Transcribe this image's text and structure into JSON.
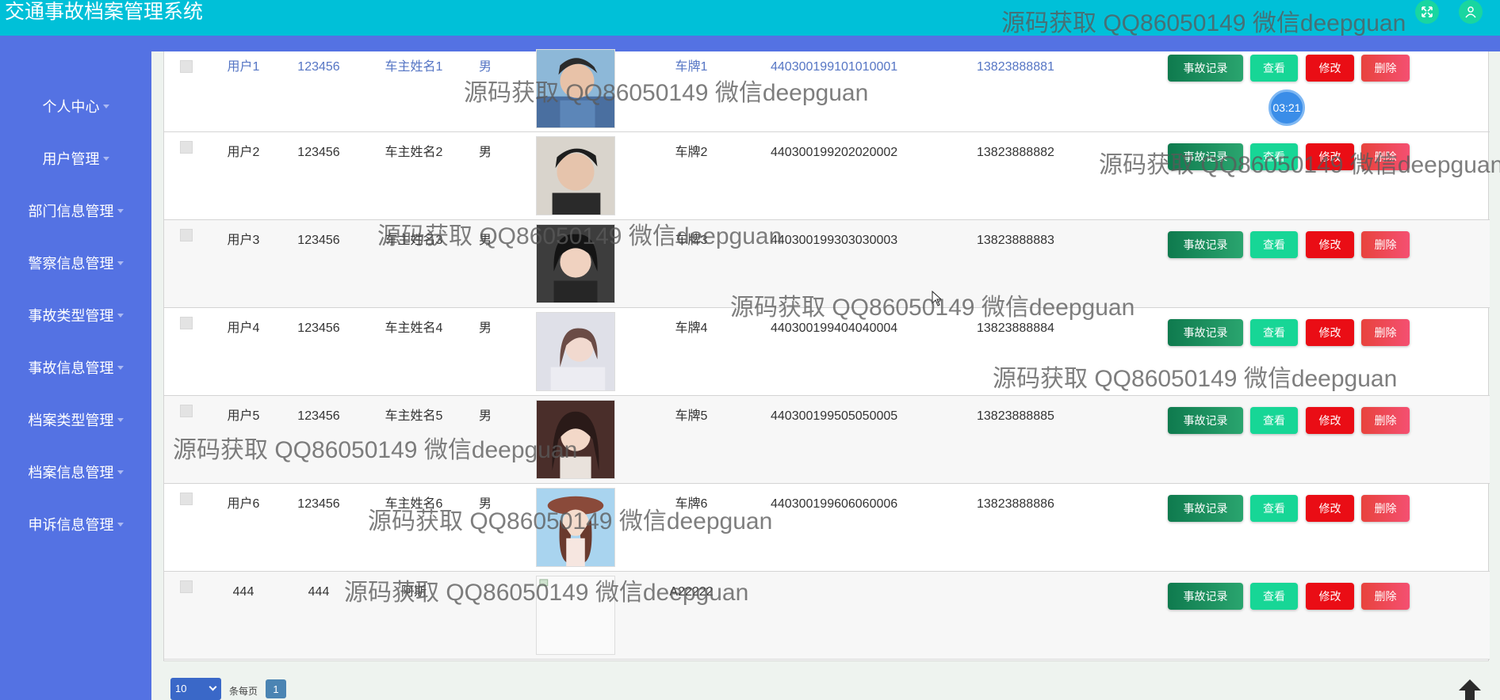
{
  "app": {
    "title": "交通事故档案管理系统"
  },
  "header": {
    "fullscreen_icon": "fullscreen-icon",
    "user_icon": "user-icon"
  },
  "sidebar": {
    "items": [
      {
        "label": "个人中心"
      },
      {
        "label": "用户管理"
      },
      {
        "label": "部门信息管理"
      },
      {
        "label": "警察信息管理"
      },
      {
        "label": "事故类型管理"
      },
      {
        "label": "事故信息管理"
      },
      {
        "label": "档案类型管理"
      },
      {
        "label": "档案信息管理"
      },
      {
        "label": "申诉信息管理"
      }
    ]
  },
  "table": {
    "rows": [
      {
        "username": "用户1",
        "password": "123456",
        "owner_name": "车主姓名1",
        "gender": "男",
        "plate": "车牌1",
        "id_number": "440300199101010001",
        "phone": "13823888881"
      },
      {
        "username": "用户2",
        "password": "123456",
        "owner_name": "车主姓名2",
        "gender": "男",
        "plate": "车牌2",
        "id_number": "440300199202020002",
        "phone": "13823888882"
      },
      {
        "username": "用户3",
        "password": "123456",
        "owner_name": "车主姓名3",
        "gender": "男",
        "plate": "车牌3",
        "id_number": "440300199303030003",
        "phone": "13823888883"
      },
      {
        "username": "用户4",
        "password": "123456",
        "owner_name": "车主姓名4",
        "gender": "男",
        "plate": "车牌4",
        "id_number": "440300199404040004",
        "phone": "13823888884"
      },
      {
        "username": "用户5",
        "password": "123456",
        "owner_name": "车主姓名5",
        "gender": "男",
        "plate": "车牌5",
        "id_number": "440300199505050005",
        "phone": "13823888885"
      },
      {
        "username": "用户6",
        "password": "123456",
        "owner_name": "车主姓名6",
        "gender": "男",
        "plate": "车牌6",
        "id_number": "440300199606060006",
        "phone": "13823888886"
      },
      {
        "username": "444",
        "password": "444",
        "owner_name": "阿斯",
        "gender": "",
        "plate": "A22222",
        "id_number": "",
        "phone": ""
      }
    ],
    "actions": {
      "record": "事故记录",
      "view": "查看",
      "edit": "修改",
      "delete": "删除"
    }
  },
  "pagination": {
    "page_size": "10",
    "per_page_label": "条每页",
    "current_page": "1"
  },
  "timer": {
    "label": "03:21"
  },
  "watermark": {
    "text": "源码获取 QQ86050149 微信deepguan"
  },
  "colors": {
    "header": "#00c0d8",
    "sidebar": "#5472e3",
    "record_btn": "#0f7a4e",
    "view_btn": "#17d696",
    "edit_btn": "#ea0d15",
    "delete_btn": "#f45071"
  }
}
